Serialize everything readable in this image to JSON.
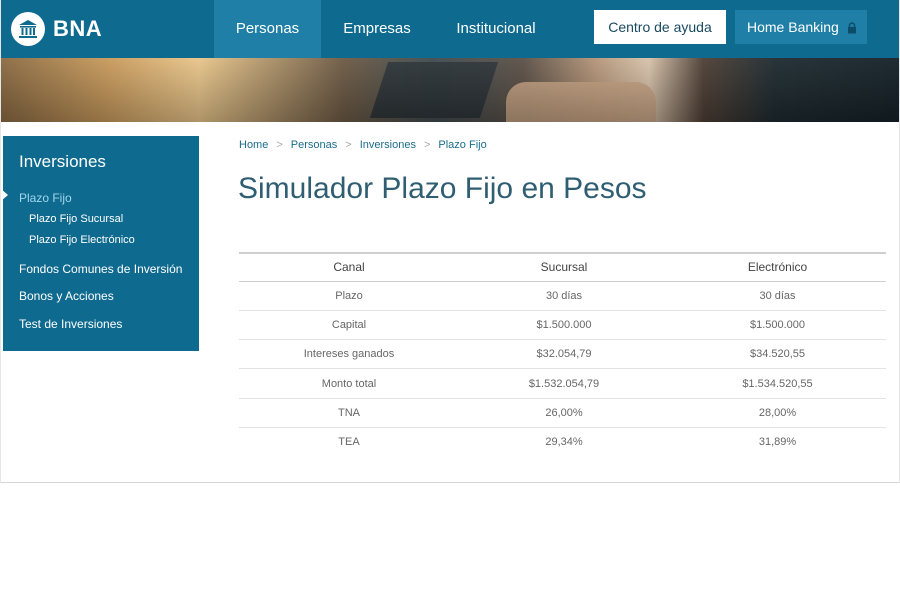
{
  "header": {
    "brand": "BNA",
    "nav": [
      {
        "label": "Personas",
        "active": true
      },
      {
        "label": "Empresas",
        "active": false
      },
      {
        "label": "Institucional",
        "active": false
      }
    ],
    "help_button": "Centro de ayuda",
    "home_banking_button": "Home Banking",
    "home_banking_icon": "lock-icon",
    "brand_color": "#0f6a8f"
  },
  "sidebar": {
    "title": "Inversiones",
    "items": [
      {
        "label": "Plazo Fijo",
        "active": true
      },
      {
        "label": "Plazo Fijo Sucursal",
        "sub": true
      },
      {
        "label": "Plazo Fijo Electrónico",
        "sub": true
      },
      {
        "label": "Fondos Comunes de Inversión"
      },
      {
        "label": "Bonos y Acciones"
      },
      {
        "label": "Test de Inversiones"
      }
    ]
  },
  "breadcrumb": [
    "Home",
    "Personas",
    "Inversiones",
    "Plazo Fijo"
  ],
  "page_title": "Simulador Plazo Fijo en Pesos",
  "table": {
    "headers": [
      "Canal",
      "Sucursal",
      "Electrónico"
    ],
    "rows": [
      [
        "Plazo",
        "30 días",
        "30 días"
      ],
      [
        "Capital",
        "$1.500.000",
        "$1.500.000"
      ],
      [
        "Intereses ganados",
        "$32.054,79",
        "$34.520,55"
      ],
      [
        "Monto total",
        "$1.532.054,79",
        "$1.534.520,55"
      ],
      [
        "TNA",
        "26,00%",
        "28,00%"
      ],
      [
        "TEA",
        "29,34%",
        "31,89%"
      ]
    ]
  }
}
